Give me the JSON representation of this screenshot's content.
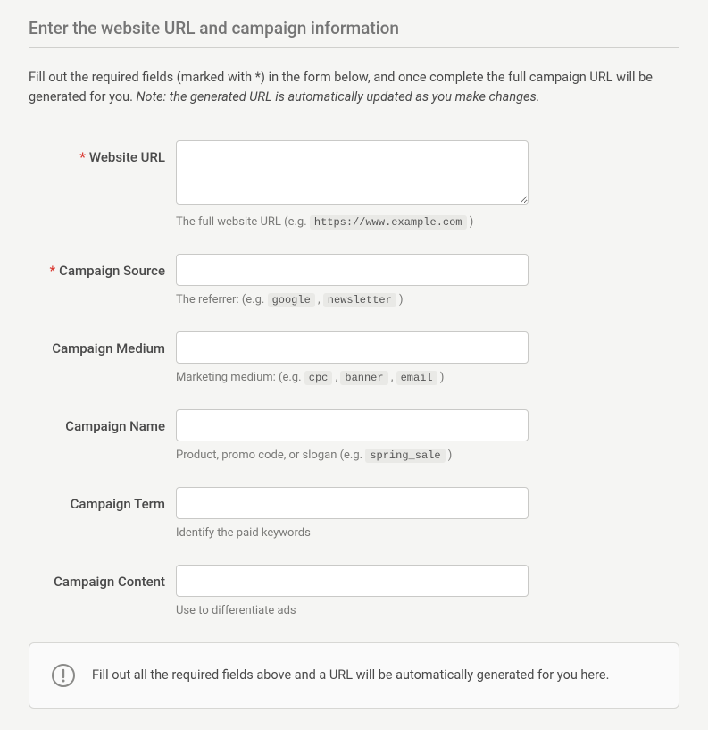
{
  "title": "Enter the website URL and campaign information",
  "intro": {
    "text": "Fill out the required fields (marked with *) in the form below, and once complete the full campaign URL will be generated for you. ",
    "note": "Note: the generated URL is automatically updated as you make changes."
  },
  "fields": {
    "website_url": {
      "label": "Website URL",
      "required_marker": "*",
      "hint_prefix": "The full website URL (e.g. ",
      "hint_code": "https://www.example.com",
      "hint_suffix": " )"
    },
    "campaign_source": {
      "label": "Campaign Source",
      "required_marker": "*",
      "hint_prefix": "The referrer: (e.g. ",
      "hint_code1": "google",
      "hint_sep": " , ",
      "hint_code2": "newsletter",
      "hint_suffix": " )"
    },
    "campaign_medium": {
      "label": "Campaign Medium",
      "hint_prefix": "Marketing medium: (e.g. ",
      "hint_code1": "cpc",
      "hint_sep1": " , ",
      "hint_code2": "banner",
      "hint_sep2": " , ",
      "hint_code3": "email",
      "hint_suffix": " )"
    },
    "campaign_name": {
      "label": "Campaign Name",
      "hint_prefix": "Product, promo code, or slogan (e.g. ",
      "hint_code": "spring_sale",
      "hint_suffix": " )"
    },
    "campaign_term": {
      "label": "Campaign Term",
      "hint": "Identify the paid keywords"
    },
    "campaign_content": {
      "label": "Campaign Content",
      "hint": "Use to differentiate ads"
    }
  },
  "notice": {
    "text": "Fill out all the required fields above and a URL will be automatically generated for you here."
  }
}
